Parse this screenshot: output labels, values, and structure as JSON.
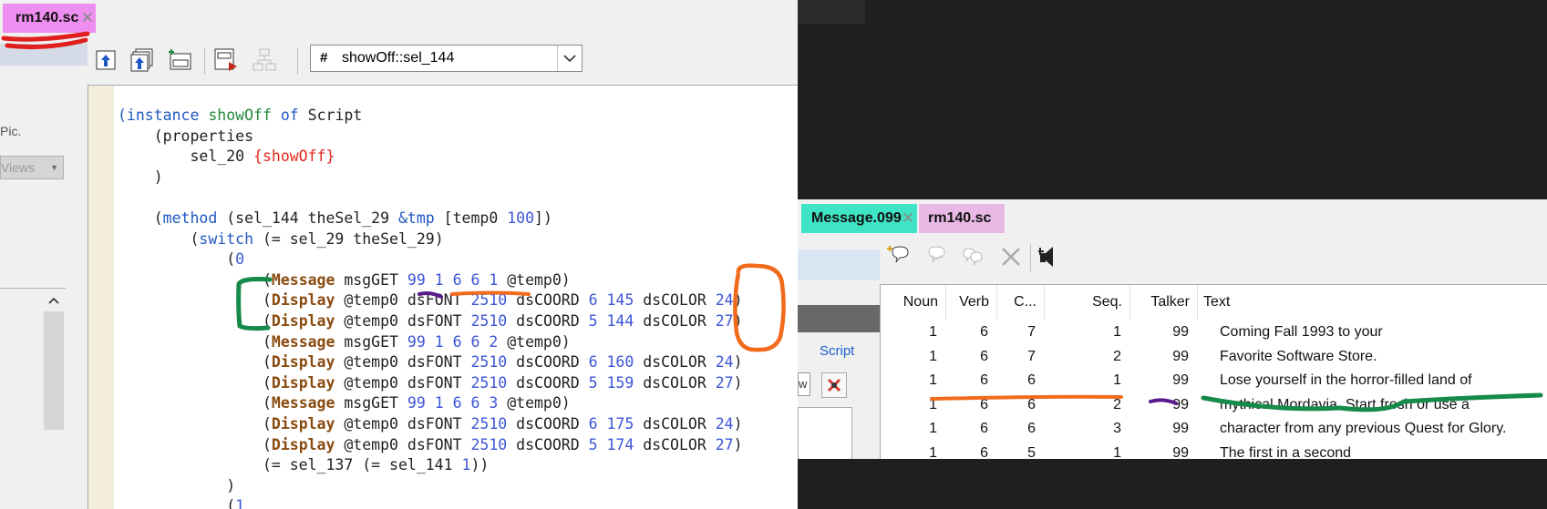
{
  "editor": {
    "tab_label": "rm140.sc",
    "method_dropdown": {
      "hash": "#",
      "value": "showOff::sel_144"
    },
    "left_panel": {
      "pic_label": "Pic.",
      "views_label": "Views"
    },
    "code_lines": [
      [
        [
          "kw",
          "(instance "
        ],
        [
          "fn",
          "showOff"
        ],
        [
          "kw",
          " of "
        ],
        [
          "pl",
          "Script"
        ]
      ],
      [
        [
          "pl",
          "    (properties"
        ]
      ],
      [
        [
          "pl",
          "        sel_20 "
        ],
        [
          "red",
          "{showOff}"
        ]
      ],
      [
        [
          "pl",
          "    )"
        ]
      ],
      [
        [
          "pl",
          ""
        ]
      ],
      [
        [
          "pl",
          "    ("
        ],
        [
          "kw",
          "method"
        ],
        [
          "pl",
          " (sel_144 theSel_29 "
        ],
        [
          "kw",
          "&tmp"
        ],
        [
          "pl",
          " [temp0 "
        ],
        [
          "nm",
          "100"
        ],
        [
          "pl",
          "])"
        ]
      ],
      [
        [
          "pl",
          "        ("
        ],
        [
          "kw",
          "switch"
        ],
        [
          "pl",
          " (= sel_29 theSel_29)"
        ]
      ],
      [
        [
          "pl",
          "            ("
        ],
        [
          "nm",
          "0"
        ]
      ],
      [
        [
          "pl",
          "                ("
        ],
        [
          "ex",
          "Message"
        ],
        [
          "pl",
          " msgGET "
        ],
        [
          "nm",
          "99 1 6 6 1"
        ],
        [
          "pl",
          " @temp0)"
        ]
      ],
      [
        [
          "pl",
          "                ("
        ],
        [
          "ex",
          "Display"
        ],
        [
          "pl",
          " @temp0 dsFONT "
        ],
        [
          "nm",
          "2510"
        ],
        [
          "pl",
          " dsCOORD "
        ],
        [
          "nm",
          "6 145"
        ],
        [
          "pl",
          " dsCOLOR "
        ],
        [
          "nm",
          "24"
        ],
        [
          "pl",
          ")"
        ]
      ],
      [
        [
          "pl",
          "                ("
        ],
        [
          "ex",
          "Display"
        ],
        [
          "pl",
          " @temp0 dsFONT "
        ],
        [
          "nm",
          "2510"
        ],
        [
          "pl",
          " dsCOORD "
        ],
        [
          "nm",
          "5 144"
        ],
        [
          "pl",
          " dsCOLOR "
        ],
        [
          "nm",
          "27"
        ],
        [
          "pl",
          ")"
        ]
      ],
      [
        [
          "pl",
          "                ("
        ],
        [
          "ex",
          "Message"
        ],
        [
          "pl",
          " msgGET "
        ],
        [
          "nm",
          "99 1 6 6 2"
        ],
        [
          "pl",
          " @temp0)"
        ]
      ],
      [
        [
          "pl",
          "                ("
        ],
        [
          "ex",
          "Display"
        ],
        [
          "pl",
          " @temp0 dsFONT "
        ],
        [
          "nm",
          "2510"
        ],
        [
          "pl",
          " dsCOORD "
        ],
        [
          "nm",
          "6 160"
        ],
        [
          "pl",
          " dsCOLOR "
        ],
        [
          "nm",
          "24"
        ],
        [
          "pl",
          ")"
        ]
      ],
      [
        [
          "pl",
          "                ("
        ],
        [
          "ex",
          "Display"
        ],
        [
          "pl",
          " @temp0 dsFONT "
        ],
        [
          "nm",
          "2510"
        ],
        [
          "pl",
          " dsCOORD "
        ],
        [
          "nm",
          "5 159"
        ],
        [
          "pl",
          " dsCOLOR "
        ],
        [
          "nm",
          "27"
        ],
        [
          "pl",
          ")"
        ]
      ],
      [
        [
          "pl",
          "                ("
        ],
        [
          "ex",
          "Message"
        ],
        [
          "pl",
          " msgGET "
        ],
        [
          "nm",
          "99 1 6 6 3"
        ],
        [
          "pl",
          " @temp0)"
        ]
      ],
      [
        [
          "pl",
          "                ("
        ],
        [
          "ex",
          "Display"
        ],
        [
          "pl",
          " @temp0 dsFONT "
        ],
        [
          "nm",
          "2510"
        ],
        [
          "pl",
          " dsCOORD "
        ],
        [
          "nm",
          "6 175"
        ],
        [
          "pl",
          " dsCOLOR "
        ],
        [
          "nm",
          "24"
        ],
        [
          "pl",
          ")"
        ]
      ],
      [
        [
          "pl",
          "                ("
        ],
        [
          "ex",
          "Display"
        ],
        [
          "pl",
          " @temp0 dsFONT "
        ],
        [
          "nm",
          "2510"
        ],
        [
          "pl",
          " dsCOORD "
        ],
        [
          "nm",
          "5 174"
        ],
        [
          "pl",
          " dsCOLOR "
        ],
        [
          "nm",
          "27"
        ],
        [
          "pl",
          ")"
        ]
      ],
      [
        [
          "pl",
          "                (= sel_137 (= sel_141 "
        ],
        [
          "nm",
          "1"
        ],
        [
          "pl",
          "))"
        ]
      ],
      [
        [
          "pl",
          "            )"
        ]
      ],
      [
        [
          "pl",
          "            ("
        ],
        [
          "nm",
          "1"
        ]
      ]
    ]
  },
  "message_editor": {
    "tabs": [
      {
        "label": "Message.099"
      },
      {
        "label": "rm140.sc"
      }
    ],
    "script_link": "Script",
    "small_button_label": "w",
    "columns": [
      "Noun",
      "Verb",
      "C...",
      "Seq.",
      "Talker",
      "Text"
    ],
    "rows": [
      [
        "1",
        "6",
        "7",
        "1",
        "99",
        "Coming Fall 1993 to your"
      ],
      [
        "1",
        "6",
        "7",
        "2",
        "99",
        "Favorite Software Store."
      ],
      [
        "1",
        "6",
        "6",
        "1",
        "99",
        "Lose yourself in the horror-filled land of"
      ],
      [
        "1",
        "6",
        "6",
        "2",
        "99",
        "mythical Mordavia. Start fresh or use a"
      ],
      [
        "1",
        "6",
        "6",
        "3",
        "99",
        "character from any previous Quest for Glory."
      ],
      [
        "1",
        "6",
        "5",
        "1",
        "99",
        "The first in a second"
      ]
    ]
  },
  "annotation_colors": {
    "red": "#e01f1f",
    "orange": "#f26a1b",
    "green": "#168a4a",
    "purple": "#5b1a8c"
  }
}
